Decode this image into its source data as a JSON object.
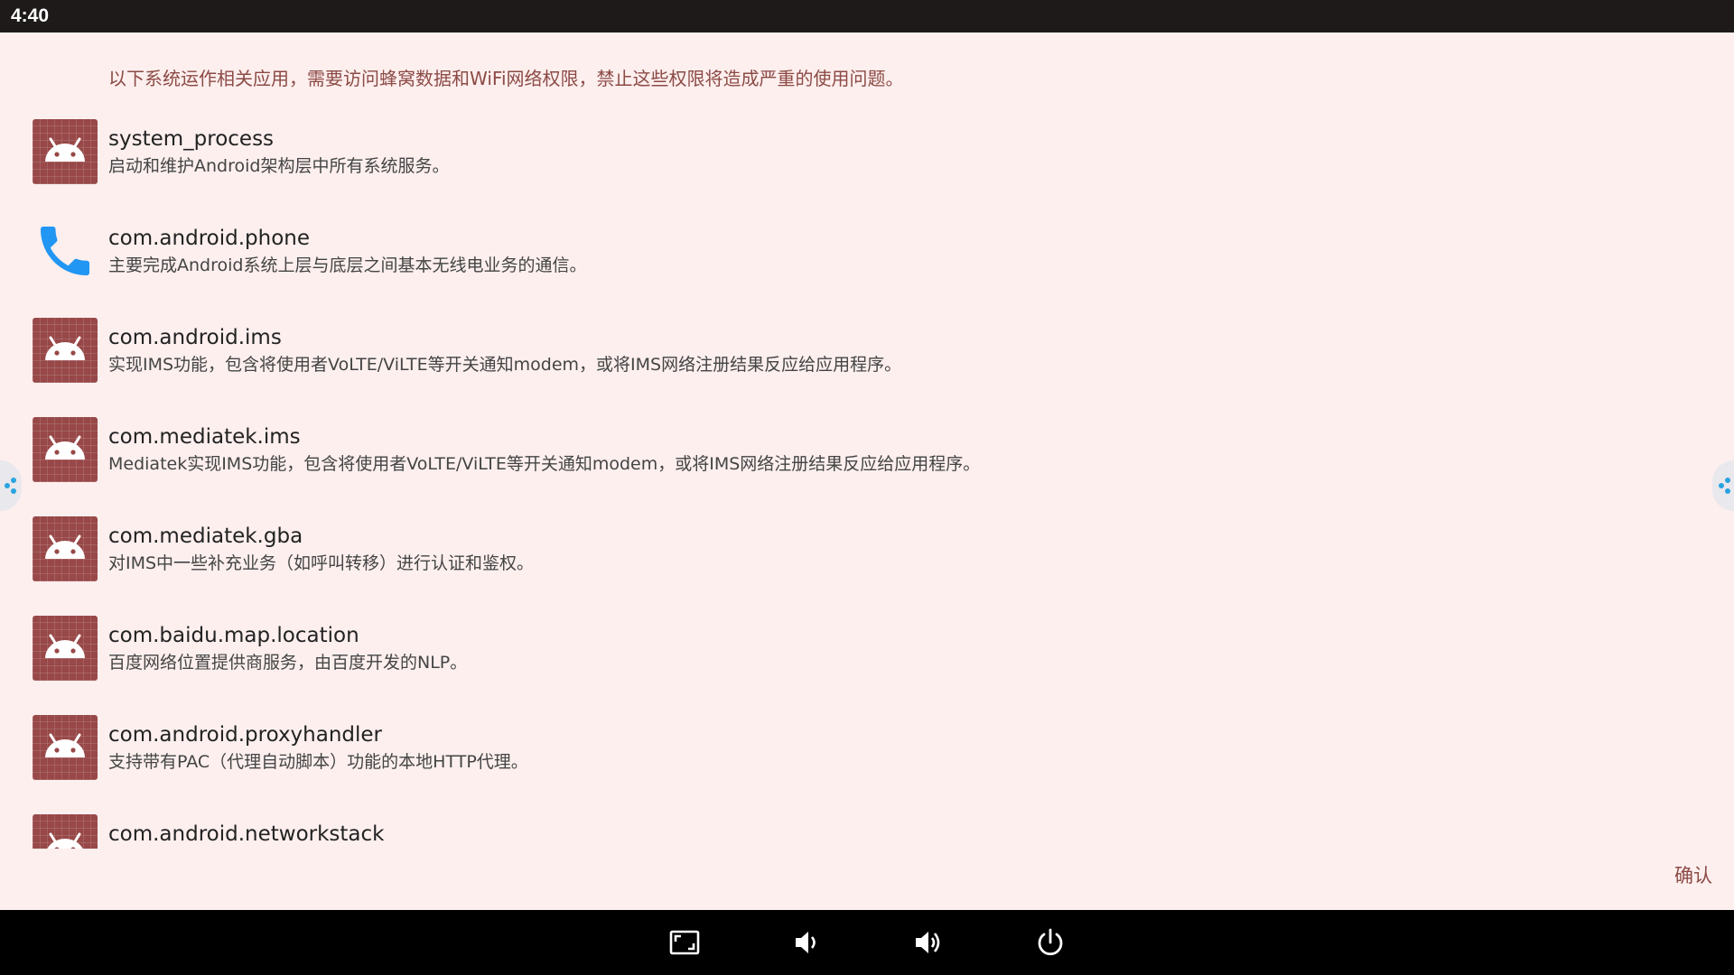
{
  "status_bar": {
    "time": "4:40"
  },
  "dialog": {
    "intro": "以下系统运作相关应用，需要访问蜂窝数据和WiFi网络权限，禁止这些权限将造成严重的使用问题。",
    "confirm_label": "确认",
    "accent_color": "#8c4a45",
    "items": [
      {
        "icon": "android-icon",
        "title": "system_process",
        "desc": "启动和维护Android架构层中所有系统服务。"
      },
      {
        "icon": "phone-icon",
        "title": "com.android.phone",
        "desc": "主要完成Android系统上层与底层之间基本无线电业务的通信。"
      },
      {
        "icon": "android-icon",
        "title": "com.android.ims",
        "desc": "实现IMS功能，包含将使用者VoLTE/ViLTE等开关通知modem，或将IMS网络注册结果反应给应用程序。"
      },
      {
        "icon": "android-icon",
        "title": "com.mediatek.ims",
        "desc": "Mediatek实现IMS功能，包含将使用者VoLTE/ViLTE等开关通知modem，或将IMS网络注册结果反应给应用程序。"
      },
      {
        "icon": "android-icon",
        "title": "com.mediatek.gba",
        "desc": "对IMS中一些补充业务（如呼叫转移）进行认证和鉴权。"
      },
      {
        "icon": "android-icon",
        "title": "com.baidu.map.location",
        "desc": "百度网络位置提供商服务，由百度开发的NLP。"
      },
      {
        "icon": "android-icon",
        "title": "com.android.proxyhandler",
        "desc": "支持带有PAC（代理自动脚本）功能的本地HTTP代理。"
      },
      {
        "icon": "android-icon",
        "title": "com.android.networkstack",
        "desc": ""
      }
    ]
  },
  "nav_bar": {
    "buttons": [
      {
        "name": "screenshot-button",
        "icon": "screenshot-icon"
      },
      {
        "name": "volume-down-button",
        "icon": "volume-down-icon"
      },
      {
        "name": "volume-up-button",
        "icon": "volume-up-icon"
      },
      {
        "name": "power-button",
        "icon": "power-icon"
      }
    ]
  }
}
